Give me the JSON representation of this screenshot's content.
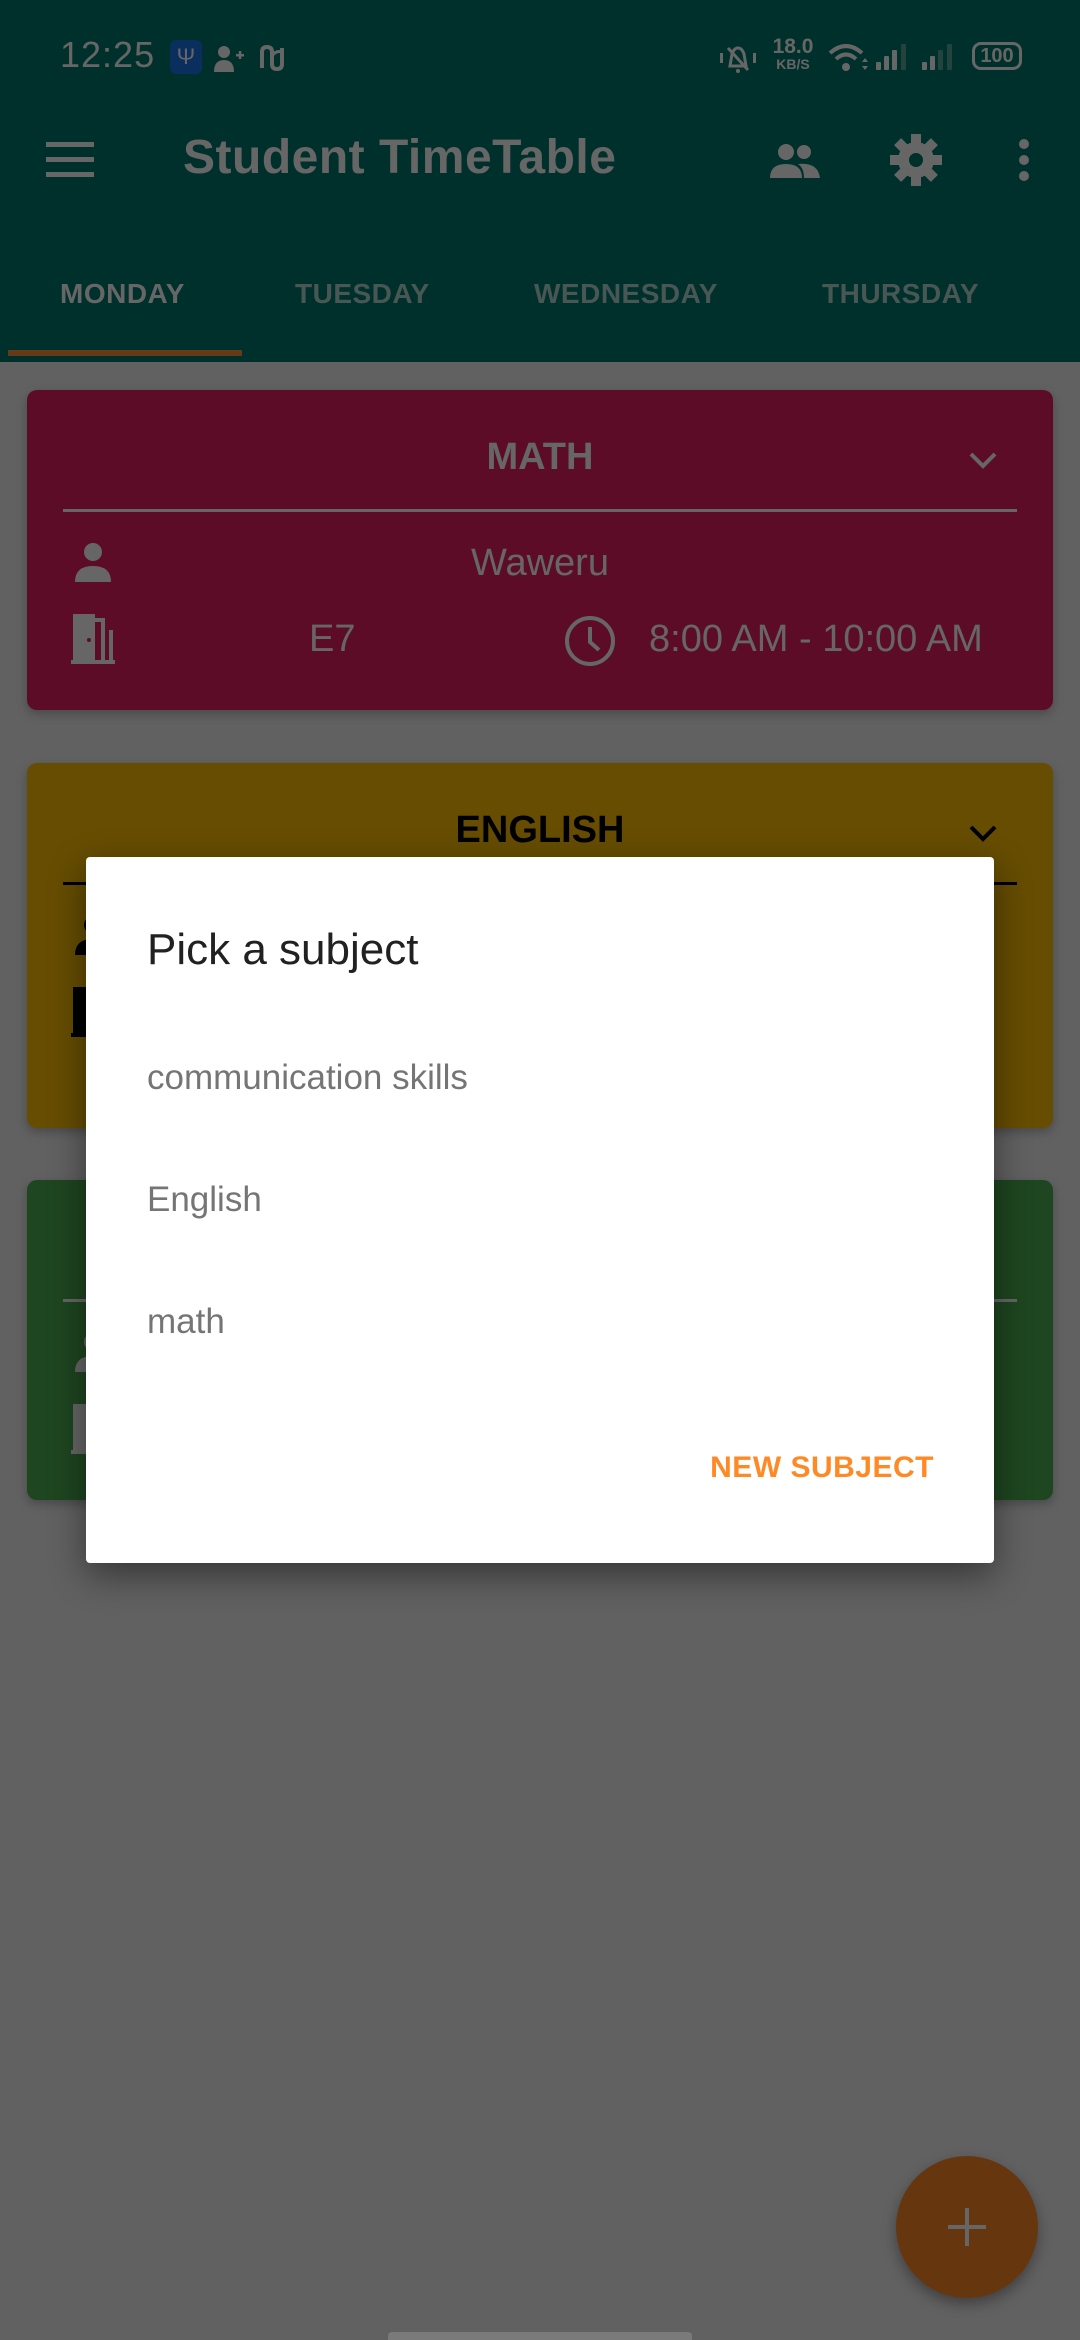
{
  "status_bar": {
    "time": "12:25",
    "icons": [
      "usb-icon",
      "add-contact-icon",
      "nfc-icon",
      "vibrate-icon",
      "wifi-icon",
      "signal-icon",
      "signal-icon"
    ],
    "usb_glyph": "Ψ",
    "net_speed_value": "18.0",
    "net_speed_unit": "KB/S",
    "battery": "100"
  },
  "app_bar": {
    "title": "Student TimeTable",
    "color": "#00796b",
    "actions": [
      "teachers-icon",
      "settings-icon",
      "more-options-icon"
    ]
  },
  "tabs": [
    {
      "label": "MONDAY",
      "active": true
    },
    {
      "label": "TUESDAY",
      "active": false
    },
    {
      "label": "WEDNESDAY",
      "active": false
    },
    {
      "label": "THURSDAY",
      "active": false
    }
  ],
  "cards": [
    {
      "subject": "MATH",
      "teacher": "Waweru",
      "room": "E7",
      "time": "8:00 AM - 10:00 AM",
      "color": "#e91e63"
    },
    {
      "subject": "ENGLISH",
      "color": "#ffc107"
    },
    {
      "subject": "",
      "color": "#4caf50"
    }
  ],
  "dialog": {
    "title": "Pick a subject",
    "items": [
      "communication skills",
      "English",
      "math"
    ],
    "button_label": "NEW SUBJECT",
    "accent": "#ff8a25"
  },
  "fab": {
    "icon": "add-icon",
    "color": "#ff8a25"
  }
}
